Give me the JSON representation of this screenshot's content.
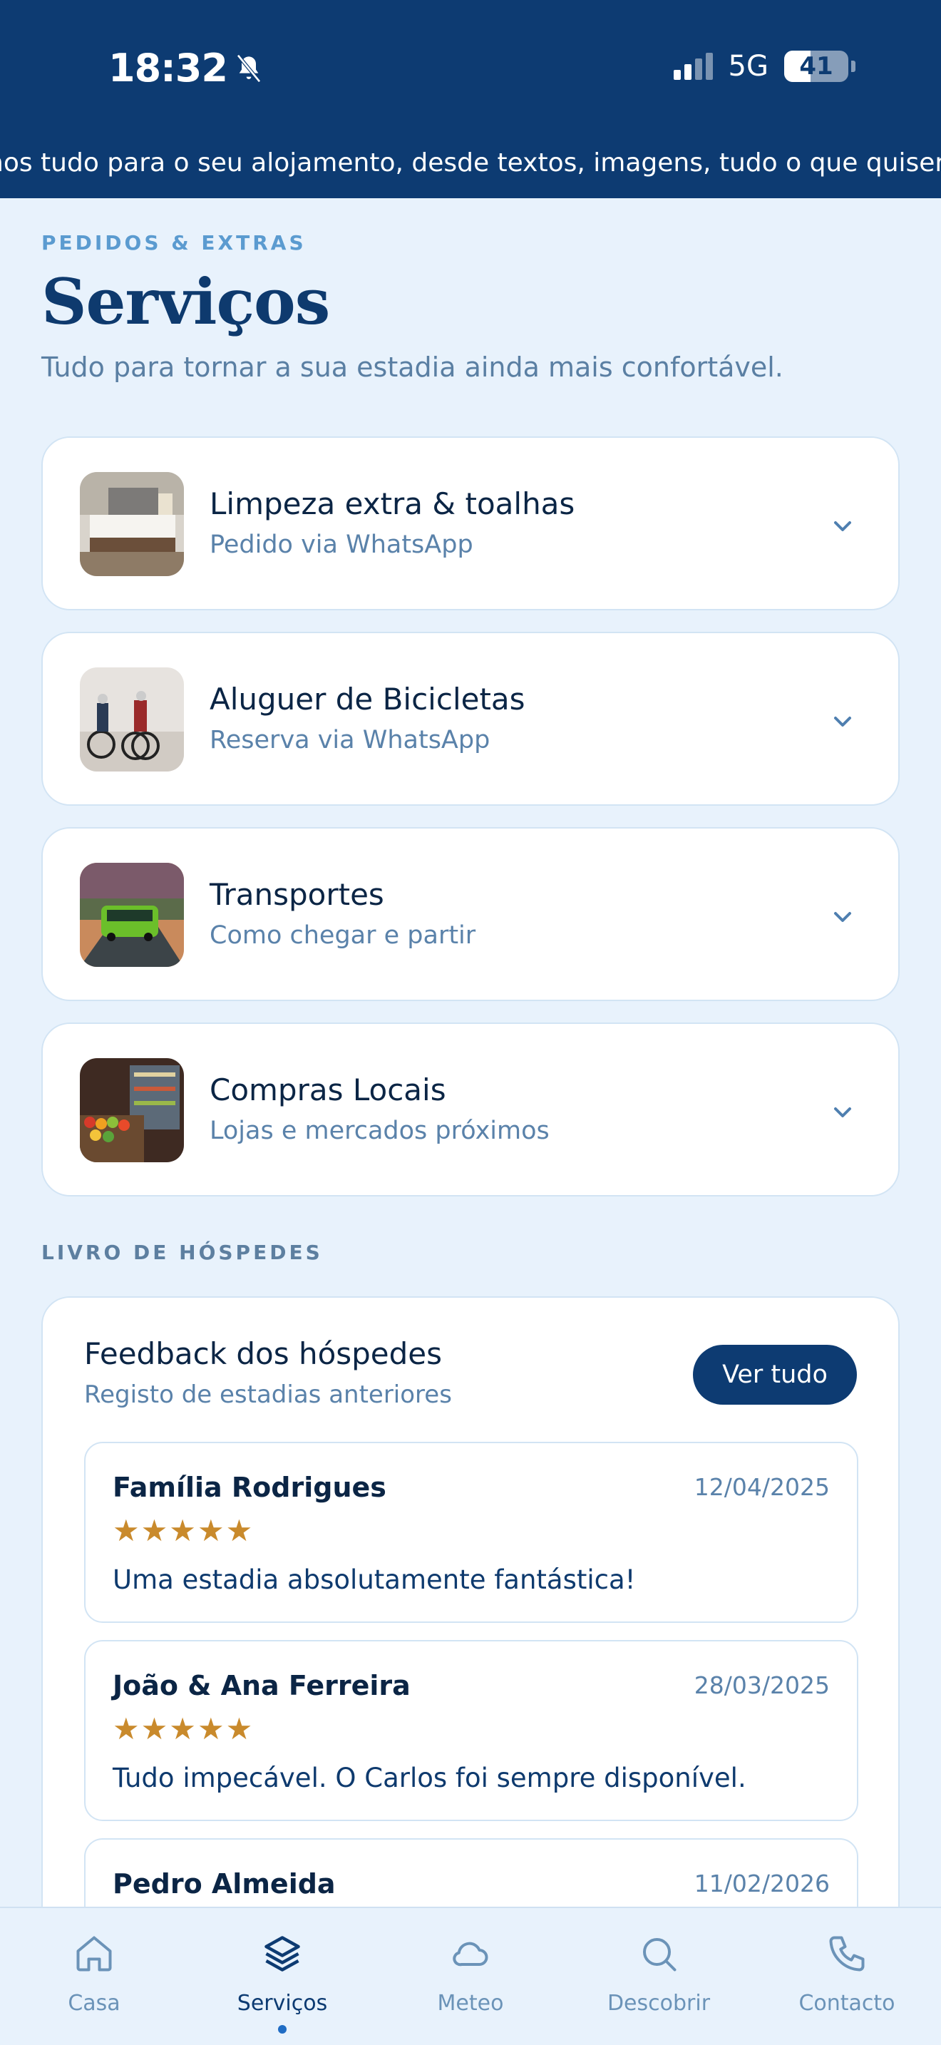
{
  "status_bar": {
    "time": "18:32",
    "network": "5G",
    "battery": "41",
    "battery_level": 0.41
  },
  "ticker_text": "nos tudo para o seu alojamento, desde textos, imagens, tudo o que quiser",
  "header": {
    "eyebrow": "PEDIDOS & EXTRAS",
    "title": "Serviços",
    "subtitle": "Tudo para tornar a sua estadia ainda mais confortável."
  },
  "services": [
    {
      "title": "Limpeza extra & toalhas",
      "subtitle": "Pedido via WhatsApp",
      "thumb": "bedroom-photo"
    },
    {
      "title": "Aluguer de Bicicletas",
      "subtitle": "Reserva via WhatsApp",
      "thumb": "cyclists-photo"
    },
    {
      "title": "Transportes",
      "subtitle": "Como chegar e partir",
      "thumb": "bus-photo"
    },
    {
      "title": "Compras Locais",
      "subtitle": "Lojas e mercados próximos",
      "thumb": "market-photo"
    }
  ],
  "guestbook": {
    "section_label": "LIVRO DE HÓSPEDES",
    "title": "Feedback dos hóspedes",
    "subtitle": "Registo de estadias anteriores",
    "view_all": "Ver tudo",
    "reviews": [
      {
        "name": "Família Rodrigues",
        "date": "12/04/2025",
        "stars": "★★★★★",
        "rating": 5,
        "text": "Uma estadia absolutamente fantástica!"
      },
      {
        "name": "João & Ana Ferreira",
        "date": "28/03/2025",
        "stars": "★★★★★",
        "rating": 5,
        "text": "Tudo impecável. O Carlos foi sempre disponível."
      },
      {
        "name": "Pedro Almeida",
        "date": "11/02/2026",
        "stars": "",
        "rating": null,
        "text": ""
      }
    ]
  },
  "nav": [
    {
      "label": "Casa",
      "icon": "home-icon"
    },
    {
      "label": "Serviços",
      "icon": "layers-icon",
      "active": true
    },
    {
      "label": "Meteo",
      "icon": "cloud-icon"
    },
    {
      "label": "Descobrir",
      "icon": "search-icon"
    },
    {
      "label": "Contacto",
      "icon": "phone-icon"
    }
  ],
  "colors": {
    "primary": "#0d3b72",
    "background": "#e8f2fc",
    "star": "#c98a2c",
    "muted": "#5a82aa"
  }
}
